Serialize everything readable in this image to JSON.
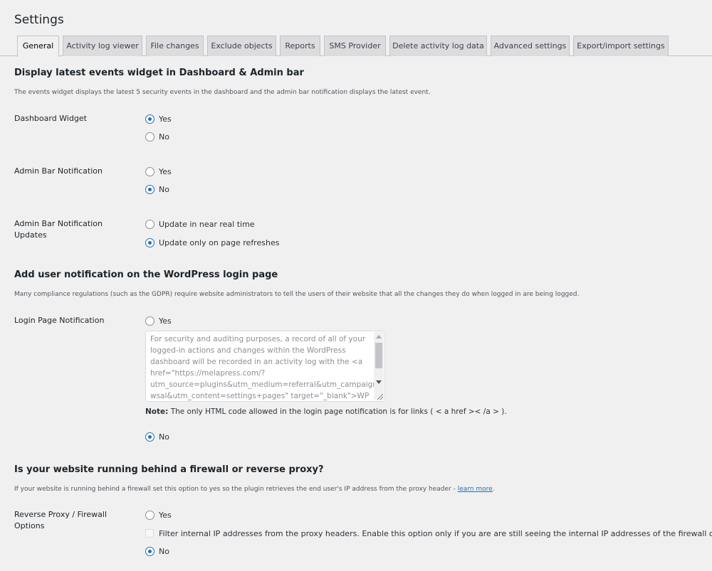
{
  "page": {
    "title": "Settings"
  },
  "tabs": [
    {
      "label": "General"
    },
    {
      "label": "Activity log viewer"
    },
    {
      "label": "File changes"
    },
    {
      "label": "Exclude objects"
    },
    {
      "label": "Reports"
    },
    {
      "label": "SMS Provider"
    },
    {
      "label": "Delete activity log data"
    },
    {
      "label": "Advanced settings"
    },
    {
      "label": "Export/import settings"
    }
  ],
  "widget_section": {
    "title": "Display latest events widget in Dashboard & Admin bar",
    "description": "The events widget displays the latest 5 security events in the dashboard and the admin bar notification displays the latest event.",
    "dashboard_widget": {
      "label": "Dashboard Widget",
      "yes": "Yes",
      "no": "No",
      "selected": "Yes"
    },
    "admin_bar_notification": {
      "label": "Admin Bar Notification",
      "yes": "Yes",
      "no": "No",
      "selected": "No"
    },
    "admin_bar_updates": {
      "label": "Admin Bar Notification Updates",
      "realtime": "Update in near real time",
      "refresh": "Update only on page refreshes",
      "selected": "Update only on page refreshes"
    }
  },
  "login_section": {
    "title": "Add user notification on the WordPress login page",
    "description": "Many compliance regulations (such as the GDPR) require website administrators to tell the users of their website that all the changes they do when logged in are being logged.",
    "login_page_notification": {
      "label": "Login Page Notification",
      "yes": "Yes",
      "no": "No",
      "selected": "No",
      "message": "For security and auditing purposes, a record of all of your\nlogged-in actions and changes within the WordPress\ndashboard will be recorded in an activity log with the <a\nhref=\"https://melapress.com/?\nutm_source=plugins&utm_medium=referral&utm_campaign=\nwsal&utm_content=settings+pages\" target=\"_blank\">WP",
      "note_label": "Note:",
      "note_text": "The only HTML code allowed in the login page notification is for links ( < a href >< /a > )."
    }
  },
  "proxy_section": {
    "title": "Is your website running behind a firewall or reverse proxy?",
    "description": "If your website is running behind a firewall set this option to yes so the plugin retrieves the end user's IP address from the proxy header -",
    "learn_more": "learn more",
    "reverse_proxy": {
      "label": "Reverse Proxy / Firewall Options",
      "yes": "Yes",
      "filter_label": "Filter internal IP addresses from the proxy headers. Enable this option only if you are are still seeing the internal IP addresses of the firewall or proxy.",
      "no": "No",
      "selected": "No"
    }
  }
}
